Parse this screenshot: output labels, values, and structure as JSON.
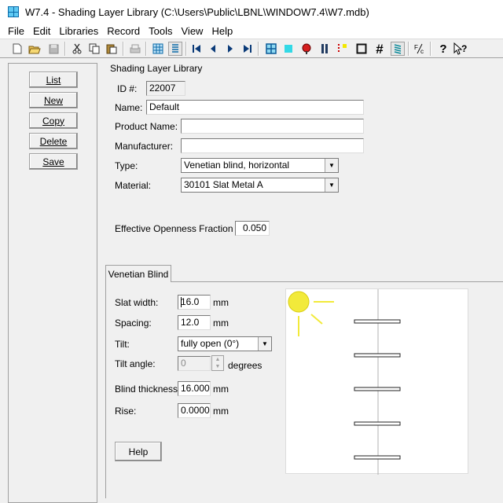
{
  "window": {
    "title": "W7.4 - Shading Layer Library (C:\\Users\\Public\\LBNL\\WINDOW7.4\\W7.mdb)"
  },
  "menu": [
    "File",
    "Edit",
    "Libraries",
    "Record",
    "Tools",
    "View",
    "Help"
  ],
  "left_buttons": {
    "list": "List",
    "new": "New",
    "copy": "Copy",
    "delete": "Delete",
    "save": "Save"
  },
  "form": {
    "section_title": "Shading Layer Library",
    "id_label": "ID #:",
    "id_value": "22007",
    "name_label": "Name:",
    "name_value": "Default",
    "product_label": "Product Name:",
    "product_value": "",
    "manufacturer_label": "Manufacturer:",
    "manufacturer_value": "",
    "type_label": "Type:",
    "type_value": "Venetian blind, horizontal",
    "material_label": "Material:",
    "material_value": "30101 Slat Metal A",
    "openness_label": "Effective Openness Fraction",
    "openness_value": "0.050"
  },
  "tab": {
    "label": "Venetian Blind"
  },
  "venetian": {
    "slat_width_label": "Slat width:",
    "slat_width_value": "16.0",
    "slat_width_unit": "mm",
    "spacing_label": "Spacing:",
    "spacing_value": "12.0",
    "spacing_unit": "mm",
    "tilt_label": "Tilt:",
    "tilt_value": "fully open (0°)",
    "tilt_angle_label": "Tilt angle:",
    "tilt_angle_value": "0",
    "tilt_angle_unit": "degrees",
    "thickness_label": "Blind thickness:",
    "thickness_value": "16.0000",
    "thickness_unit": "mm",
    "rise_label": "Rise:",
    "rise_value": "0.00000",
    "rise_unit": "mm",
    "help_label": "Help"
  },
  "toolbar": {
    "icons": [
      "new-file-icon",
      "open-folder-icon",
      "save-disk-icon",
      "cut-icon",
      "copy-icon",
      "paste-icon",
      "print-icon",
      "grid-view-icon",
      "dropdown-list-icon",
      "first-record-icon",
      "previous-record-icon",
      "next-record-icon",
      "last-record-icon",
      "glazing-system-icon",
      "glass-icon",
      "gas-icon",
      "shading-icon",
      "frame-icon",
      "divider-icon",
      "hash-icon",
      "blind-icon",
      "fraction-icon",
      "help-icon",
      "whats-this-icon"
    ]
  },
  "colors": {
    "sun": "#f2ea3a",
    "accent": "#0a6aa8",
    "highlight": "#33d9e6"
  }
}
